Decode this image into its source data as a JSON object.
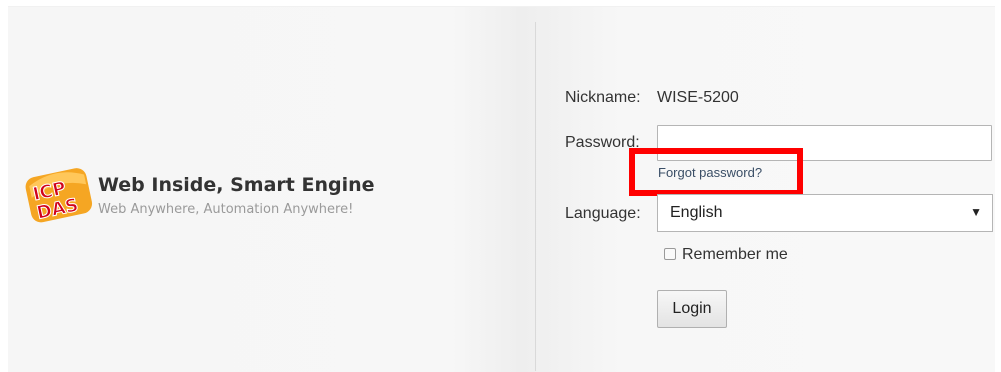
{
  "brand": {
    "logo_text": "ICP DAS",
    "title": "Web Inside, Smart Engine",
    "subtitle": "Web Anywhere, Automation Anywhere!"
  },
  "form": {
    "nickname_label": "Nickname:",
    "nickname_value": "WISE-5200",
    "password_label": "Password:",
    "password_value": "",
    "forgot_link": "Forgot password?",
    "language_label": "Language:",
    "language_selected": "English",
    "remember_label": "Remember me",
    "remember_checked": false,
    "login_button": "Login"
  },
  "colors": {
    "highlight": "#ff0000",
    "logo_orange": "#f5a623",
    "logo_red": "#d0021b"
  },
  "icons": {
    "select_arrow": "dropdown-arrow-icon"
  }
}
